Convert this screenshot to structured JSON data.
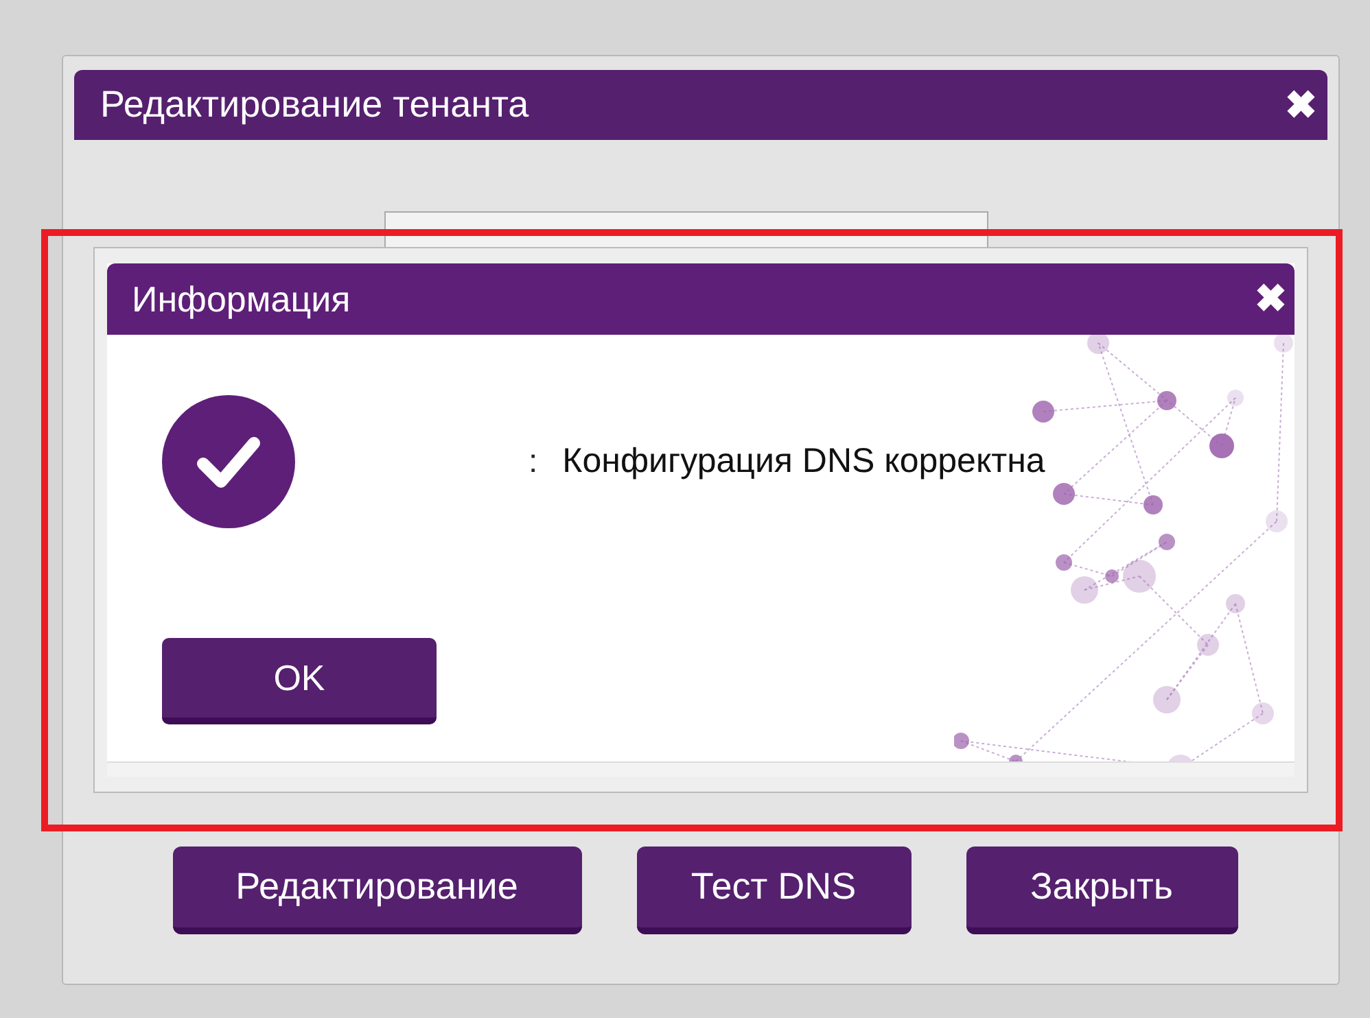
{
  "window": {
    "title": "Редактирование тенанта",
    "close": "✖"
  },
  "buttons": [
    "Редактирование",
    "Тест DNS",
    "Закрыть"
  ],
  "info_dialog": {
    "title": "Информация",
    "close": "✖",
    "separator": ":",
    "message": "Конфигурация DNS корректна",
    "ok_button": "OK"
  }
}
